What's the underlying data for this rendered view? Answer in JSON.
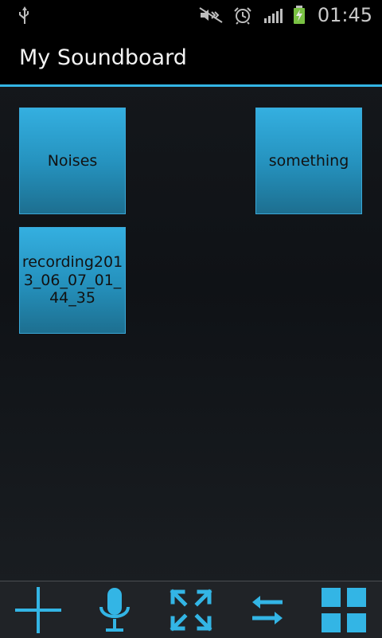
{
  "status_bar": {
    "time": "01:45",
    "icons": [
      "usb-icon",
      "mute-icon",
      "alarm-icon",
      "signal-icon",
      "battery-charging-icon"
    ]
  },
  "app": {
    "title": "My Soundboard"
  },
  "tiles": [
    {
      "label": "Noises"
    },
    {
      "label": "something"
    },
    {
      "label": "recording2013_06_07_01_44_35"
    }
  ],
  "toolbar": {
    "icons": [
      "add-icon",
      "microphone-icon",
      "expand-icon",
      "swap-icon",
      "grid-icon"
    ]
  },
  "colors": {
    "accent": "#33b5e5",
    "tile_top": "#34afe0",
    "tile_bottom": "#1d6f90"
  }
}
